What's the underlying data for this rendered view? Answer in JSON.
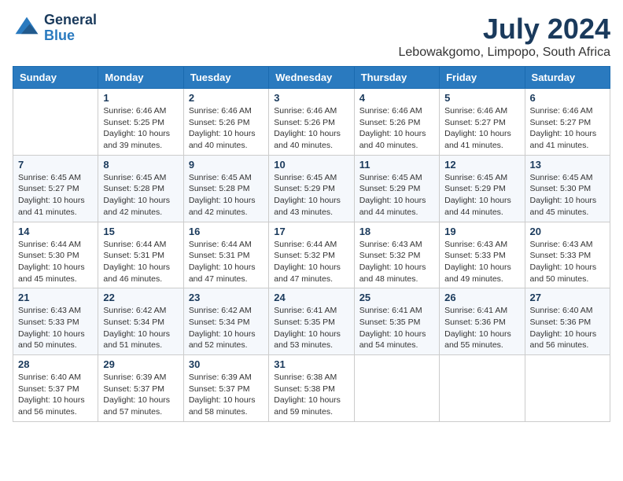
{
  "logo": {
    "line1": "General",
    "line2": "Blue"
  },
  "title": "July 2024",
  "location": "Lebowakgomo, Limpopo, South Africa",
  "days_header": [
    "Sunday",
    "Monday",
    "Tuesday",
    "Wednesday",
    "Thursday",
    "Friday",
    "Saturday"
  ],
  "weeks": [
    [
      {
        "day": "",
        "sunrise": "",
        "sunset": "",
        "daylight": ""
      },
      {
        "day": "1",
        "sunrise": "Sunrise: 6:46 AM",
        "sunset": "Sunset: 5:25 PM",
        "daylight": "Daylight: 10 hours and 39 minutes."
      },
      {
        "day": "2",
        "sunrise": "Sunrise: 6:46 AM",
        "sunset": "Sunset: 5:26 PM",
        "daylight": "Daylight: 10 hours and 40 minutes."
      },
      {
        "day": "3",
        "sunrise": "Sunrise: 6:46 AM",
        "sunset": "Sunset: 5:26 PM",
        "daylight": "Daylight: 10 hours and 40 minutes."
      },
      {
        "day": "4",
        "sunrise": "Sunrise: 6:46 AM",
        "sunset": "Sunset: 5:26 PM",
        "daylight": "Daylight: 10 hours and 40 minutes."
      },
      {
        "day": "5",
        "sunrise": "Sunrise: 6:46 AM",
        "sunset": "Sunset: 5:27 PM",
        "daylight": "Daylight: 10 hours and 41 minutes."
      },
      {
        "day": "6",
        "sunrise": "Sunrise: 6:46 AM",
        "sunset": "Sunset: 5:27 PM",
        "daylight": "Daylight: 10 hours and 41 minutes."
      }
    ],
    [
      {
        "day": "7",
        "sunrise": "Sunrise: 6:45 AM",
        "sunset": "Sunset: 5:27 PM",
        "daylight": "Daylight: 10 hours and 41 minutes."
      },
      {
        "day": "8",
        "sunrise": "Sunrise: 6:45 AM",
        "sunset": "Sunset: 5:28 PM",
        "daylight": "Daylight: 10 hours and 42 minutes."
      },
      {
        "day": "9",
        "sunrise": "Sunrise: 6:45 AM",
        "sunset": "Sunset: 5:28 PM",
        "daylight": "Daylight: 10 hours and 42 minutes."
      },
      {
        "day": "10",
        "sunrise": "Sunrise: 6:45 AM",
        "sunset": "Sunset: 5:29 PM",
        "daylight": "Daylight: 10 hours and 43 minutes."
      },
      {
        "day": "11",
        "sunrise": "Sunrise: 6:45 AM",
        "sunset": "Sunset: 5:29 PM",
        "daylight": "Daylight: 10 hours and 44 minutes."
      },
      {
        "day": "12",
        "sunrise": "Sunrise: 6:45 AM",
        "sunset": "Sunset: 5:29 PM",
        "daylight": "Daylight: 10 hours and 44 minutes."
      },
      {
        "day": "13",
        "sunrise": "Sunrise: 6:45 AM",
        "sunset": "Sunset: 5:30 PM",
        "daylight": "Daylight: 10 hours and 45 minutes."
      }
    ],
    [
      {
        "day": "14",
        "sunrise": "Sunrise: 6:44 AM",
        "sunset": "Sunset: 5:30 PM",
        "daylight": "Daylight: 10 hours and 45 minutes."
      },
      {
        "day": "15",
        "sunrise": "Sunrise: 6:44 AM",
        "sunset": "Sunset: 5:31 PM",
        "daylight": "Daylight: 10 hours and 46 minutes."
      },
      {
        "day": "16",
        "sunrise": "Sunrise: 6:44 AM",
        "sunset": "Sunset: 5:31 PM",
        "daylight": "Daylight: 10 hours and 47 minutes."
      },
      {
        "day": "17",
        "sunrise": "Sunrise: 6:44 AM",
        "sunset": "Sunset: 5:32 PM",
        "daylight": "Daylight: 10 hours and 47 minutes."
      },
      {
        "day": "18",
        "sunrise": "Sunrise: 6:43 AM",
        "sunset": "Sunset: 5:32 PM",
        "daylight": "Daylight: 10 hours and 48 minutes."
      },
      {
        "day": "19",
        "sunrise": "Sunrise: 6:43 AM",
        "sunset": "Sunset: 5:33 PM",
        "daylight": "Daylight: 10 hours and 49 minutes."
      },
      {
        "day": "20",
        "sunrise": "Sunrise: 6:43 AM",
        "sunset": "Sunset: 5:33 PM",
        "daylight": "Daylight: 10 hours and 50 minutes."
      }
    ],
    [
      {
        "day": "21",
        "sunrise": "Sunrise: 6:43 AM",
        "sunset": "Sunset: 5:33 PM",
        "daylight": "Daylight: 10 hours and 50 minutes."
      },
      {
        "day": "22",
        "sunrise": "Sunrise: 6:42 AM",
        "sunset": "Sunset: 5:34 PM",
        "daylight": "Daylight: 10 hours and 51 minutes."
      },
      {
        "day": "23",
        "sunrise": "Sunrise: 6:42 AM",
        "sunset": "Sunset: 5:34 PM",
        "daylight": "Daylight: 10 hours and 52 minutes."
      },
      {
        "day": "24",
        "sunrise": "Sunrise: 6:41 AM",
        "sunset": "Sunset: 5:35 PM",
        "daylight": "Daylight: 10 hours and 53 minutes."
      },
      {
        "day": "25",
        "sunrise": "Sunrise: 6:41 AM",
        "sunset": "Sunset: 5:35 PM",
        "daylight": "Daylight: 10 hours and 54 minutes."
      },
      {
        "day": "26",
        "sunrise": "Sunrise: 6:41 AM",
        "sunset": "Sunset: 5:36 PM",
        "daylight": "Daylight: 10 hours and 55 minutes."
      },
      {
        "day": "27",
        "sunrise": "Sunrise: 6:40 AM",
        "sunset": "Sunset: 5:36 PM",
        "daylight": "Daylight: 10 hours and 56 minutes."
      }
    ],
    [
      {
        "day": "28",
        "sunrise": "Sunrise: 6:40 AM",
        "sunset": "Sunset: 5:37 PM",
        "daylight": "Daylight: 10 hours and 56 minutes."
      },
      {
        "day": "29",
        "sunrise": "Sunrise: 6:39 AM",
        "sunset": "Sunset: 5:37 PM",
        "daylight": "Daylight: 10 hours and 57 minutes."
      },
      {
        "day": "30",
        "sunrise": "Sunrise: 6:39 AM",
        "sunset": "Sunset: 5:37 PM",
        "daylight": "Daylight: 10 hours and 58 minutes."
      },
      {
        "day": "31",
        "sunrise": "Sunrise: 6:38 AM",
        "sunset": "Sunset: 5:38 PM",
        "daylight": "Daylight: 10 hours and 59 minutes."
      },
      {
        "day": "",
        "sunrise": "",
        "sunset": "",
        "daylight": ""
      },
      {
        "day": "",
        "sunrise": "",
        "sunset": "",
        "daylight": ""
      },
      {
        "day": "",
        "sunrise": "",
        "sunset": "",
        "daylight": ""
      }
    ]
  ]
}
